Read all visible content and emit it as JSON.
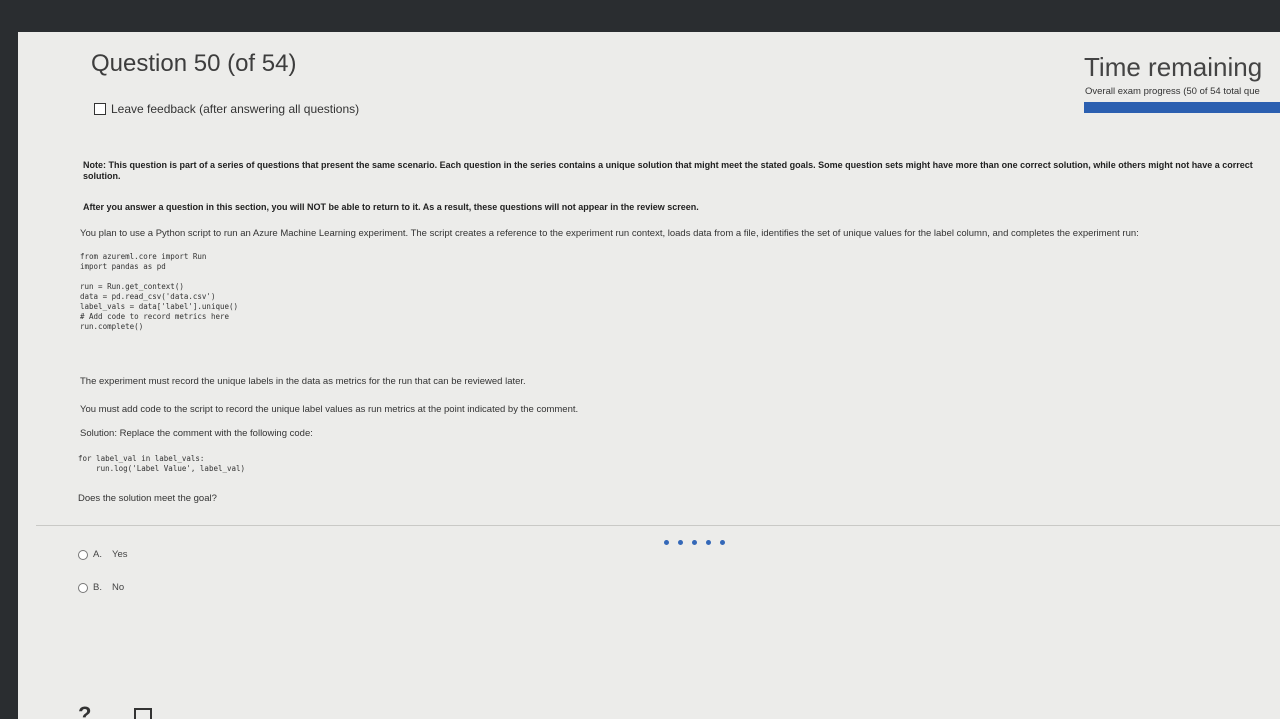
{
  "header": {
    "question_title": "Question 50 (of 54)",
    "feedback_label": "Leave feedback (after answering all questions)",
    "time_label": "Time remaining",
    "progress_text": "Overall exam progress (50 of 54 total que",
    "progress_color": "#2b5fb0"
  },
  "body": {
    "note": "Note: This question is part of a series of questions that present the same scenario. Each question in the series contains a unique solution that might meet the stated goals. Some question sets might have more than one correct solution, while others might not have a correct solution.",
    "after_answer": "After you answer a question in this section, you will NOT be able to return to it. As a result, these questions will not appear in the review screen.",
    "intro": "You plan to use a Python script to run an Azure Machine Learning experiment. The script creates a reference to the experiment run context, loads data from a file, identifies the set of unique values for the label column, and completes the experiment run:",
    "code_block": "from azureml.core import Run\nimport pandas as pd\n\nrun = Run.get_context()\ndata = pd.read_csv('data.csv')\nlabel_vals = data['label'].unique()\n# Add code to record metrics here\nrun.complete()",
    "requirement1": "The experiment must record the unique labels in the data as metrics for the run that can be reviewed later.",
    "requirement2": "You must add code to the script to record the unique label values as run metrics at the point indicated by the comment.",
    "solution_label": "Solution: Replace the comment with the following code:",
    "solution_code": "for label_val in label_vals:\n    run.log('Label Value', label_val)",
    "question": "Does the solution meet the goal?"
  },
  "options": [
    {
      "letter": "A.",
      "text": "Yes"
    },
    {
      "letter": "B.",
      "text": "No"
    }
  ],
  "footer": {
    "help_icon_text": "?"
  }
}
